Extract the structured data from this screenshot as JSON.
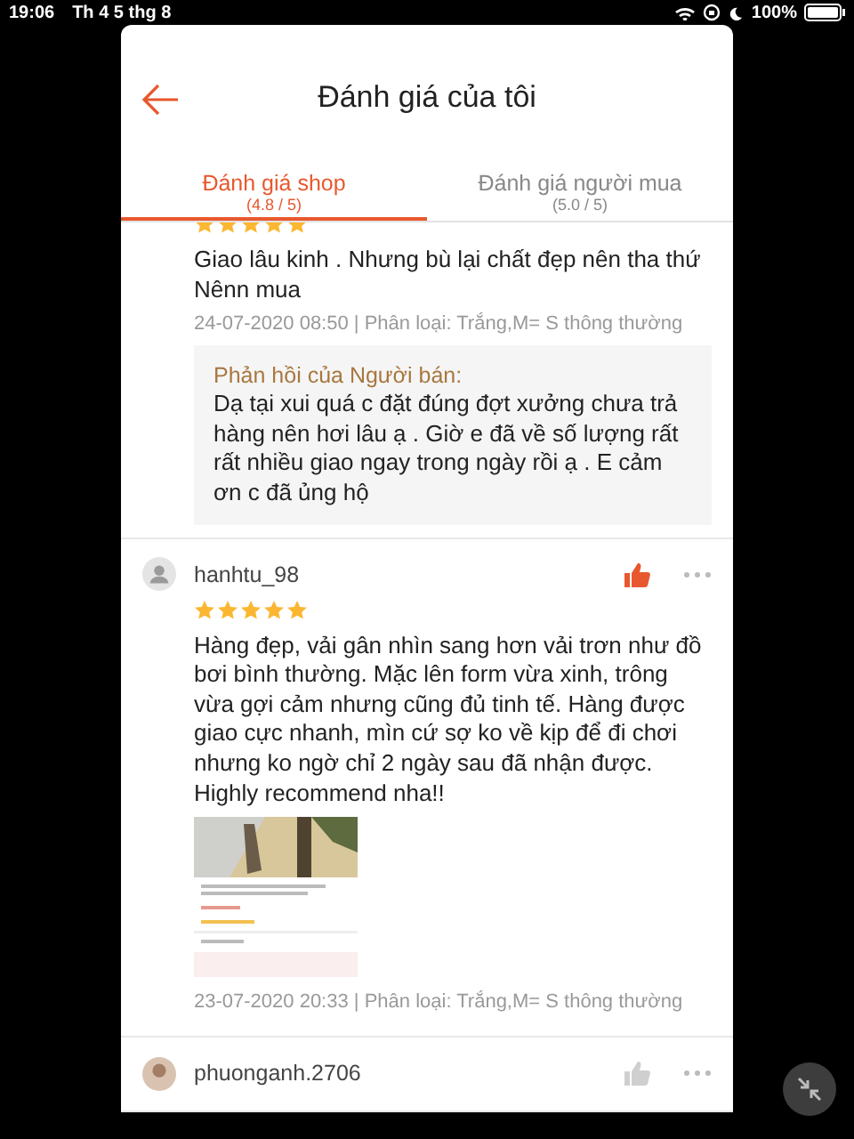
{
  "status_bar": {
    "time": "19:06",
    "date": "Th 4 5 thg 8",
    "battery": "100%"
  },
  "header": {
    "title": "Đánh giá của tôi"
  },
  "tabs": [
    {
      "label": "Đánh giá shop",
      "score": "(4.8 / 5)",
      "selected": true
    },
    {
      "label": "Đánh giá người mua",
      "score": "(5.0 / 5)",
      "selected": false
    }
  ],
  "reviews": [
    {
      "stars": 5,
      "text": "Giao lâu kinh . Nhưng bù lại chất đẹp nên tha thứ\nNênn mua",
      "meta": "24-07-2020 08:50 | Phân loại: Trắng,M= S thông thường",
      "seller_reply": {
        "label": "Phản hồi của Người bán:",
        "text": "Dạ tại xui quá c đặt đúng đợt xưởng chưa trả hàng nên hơi lâu ạ . Giờ e đã về số lượng rất rất nhiều giao ngay trong ngày rồi ạ . E cảm ơn c đã ủng hộ"
      }
    },
    {
      "user": "hanhtu_98",
      "avatar": {
        "kind": "icon"
      },
      "liked": true,
      "stars": 5,
      "text": "Hàng đẹp, vải gân nhìn sang hơn vải trơn như đồ bơi bình thường. Mặc lên form vừa xinh, trông vừa gợi cảm nhưng cũng đủ tinh tế. Hàng được giao cực nhanh, mìn cứ sợ ko về kịp để đi chơi nhưng ko ngờ chỉ 2 ngày sau đã nhận được. Highly recommend nha!!",
      "meta": "23-07-2020 20:33 | Phân loại: Trắng,M= S thông thường"
    },
    {
      "user": "phuonganh.2706",
      "liked": false
    }
  ]
}
